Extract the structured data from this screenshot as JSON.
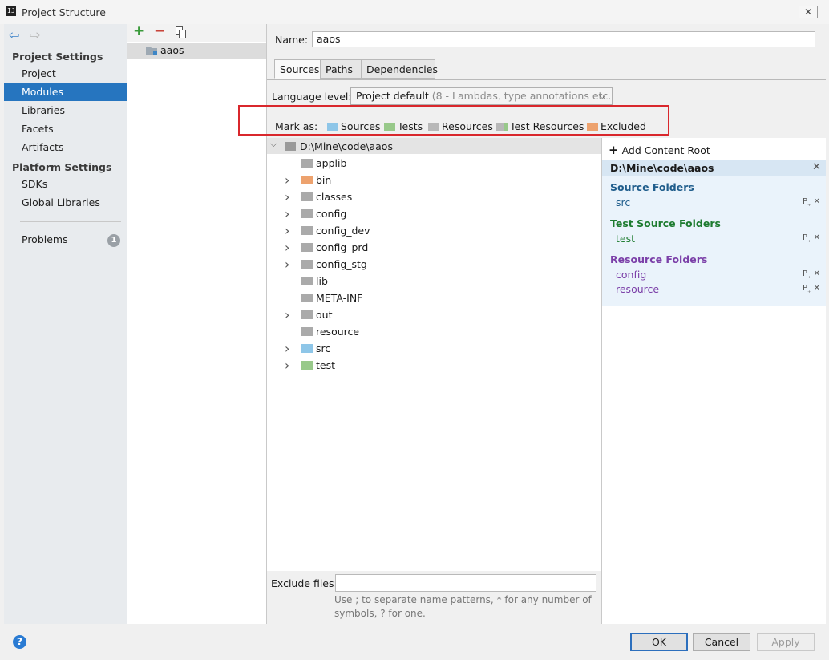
{
  "window": {
    "title": "Project Structure",
    "close": "✕",
    "app_icon_text": "IJ"
  },
  "sidebar": {
    "back_icon": "⇦",
    "forward_icon": "⇨",
    "project_settings_header": "Project Settings",
    "project_settings": [
      "Project",
      "Modules",
      "Libraries",
      "Facets",
      "Artifacts"
    ],
    "platform_settings_header": "Platform Settings",
    "platform_settings": [
      "SDKs",
      "Global Libraries"
    ],
    "problems_label": "Problems",
    "problems_count": "1",
    "selected": "Modules"
  },
  "modules": {
    "toolbar": {
      "add": "+",
      "remove": "−"
    },
    "items": [
      "aaos"
    ]
  },
  "module_settings": {
    "name_label": "Name:",
    "name_value": "aaos",
    "tabs": [
      "Sources",
      "Paths",
      "Dependencies"
    ],
    "active_tab": "Sources",
    "language_level_label": "Language level:",
    "language_level_value": "Project default",
    "language_level_hint": "(8 - Lambdas, type annotations etc.)",
    "mark_as_label": "Mark as:",
    "mark_as": [
      {
        "label": "Sources",
        "color": "#8ec6e8"
      },
      {
        "label": "Tests",
        "color": "#98c98a"
      },
      {
        "label": "Resources",
        "color": "#b8b8b8"
      },
      {
        "label": "Test Resources",
        "color": "#b8b8b8"
      },
      {
        "label": "Excluded",
        "color": "#eda26e"
      }
    ]
  },
  "tree": {
    "root": "D:\\Mine\\code\\aaos",
    "items": [
      {
        "label": "applib",
        "expandable": false,
        "color": "#aaaaaa"
      },
      {
        "label": "bin",
        "expandable": true,
        "color": "#eda26e"
      },
      {
        "label": "classes",
        "expandable": true,
        "color": "#aaaaaa"
      },
      {
        "label": "config",
        "expandable": true,
        "color": "#aaaaaa"
      },
      {
        "label": "config_dev",
        "expandable": true,
        "color": "#aaaaaa"
      },
      {
        "label": "config_prd",
        "expandable": true,
        "color": "#aaaaaa"
      },
      {
        "label": "config_stg",
        "expandable": true,
        "color": "#aaaaaa"
      },
      {
        "label": "lib",
        "expandable": false,
        "color": "#aaaaaa"
      },
      {
        "label": "META-INF",
        "expandable": false,
        "color": "#aaaaaa"
      },
      {
        "label": "out",
        "expandable": true,
        "color": "#aaaaaa"
      },
      {
        "label": "resource",
        "expandable": false,
        "color": "#aaaaaa"
      },
      {
        "label": "src",
        "expandable": true,
        "color": "#8ec6e8"
      },
      {
        "label": "test",
        "expandable": true,
        "color": "#98c98a"
      }
    ]
  },
  "exclude": {
    "label": "Exclude files:",
    "value": "",
    "hint": "Use ; to separate name patterns, * for any number of symbols, ? for one."
  },
  "content_roots": {
    "add_label": "Add Content Root",
    "root_path": "D:\\Mine\\code\\aaos",
    "source_folders_header": "Source Folders",
    "source_folders": [
      "src"
    ],
    "test_source_folders_header": "Test Source Folders",
    "test_source_folders": [
      "test"
    ],
    "resource_folders_header": "Resource Folders",
    "resource_folders": [
      "config",
      "resource"
    ],
    "colors": {
      "source": "#1f5d8c",
      "test": "#1d7b2f",
      "resource": "#7b3fa8"
    }
  },
  "footer": {
    "help": "?",
    "ok": "OK",
    "cancel": "Cancel",
    "apply": "Apply"
  }
}
